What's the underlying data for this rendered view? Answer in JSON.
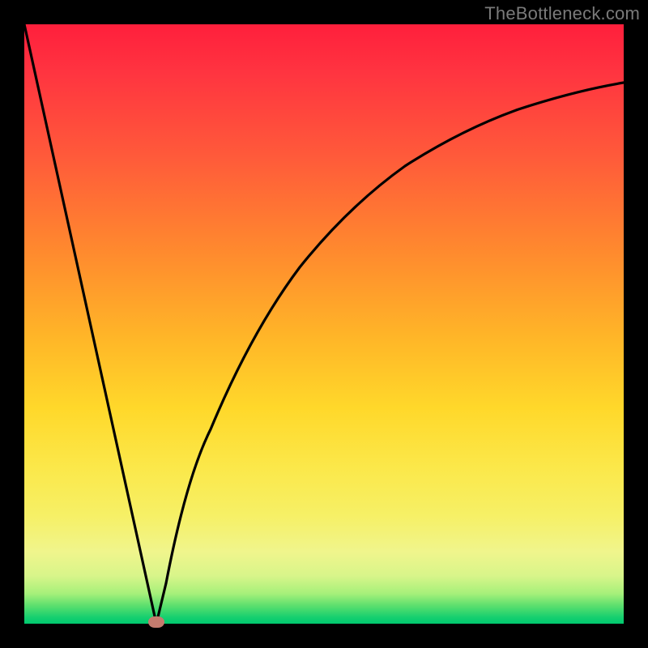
{
  "watermark": "TheBottleneck.com",
  "colors": {
    "curve": "#000000",
    "marker": "#c47b6e",
    "frame": "#000000"
  },
  "chart_data": {
    "type": "line",
    "title": "",
    "xlabel": "",
    "ylabel": "",
    "xlim": [
      0,
      100
    ],
    "ylim": [
      0,
      100
    ],
    "grid": false,
    "legend": false,
    "background_gradient": [
      "#ff1f3c",
      "#ff8a2e",
      "#ffd82a",
      "#f0f58c",
      "#00c96f"
    ],
    "series": [
      {
        "name": "left-branch",
        "x": [
          0,
          5,
          10,
          15,
          18,
          20,
          21,
          22
        ],
        "values": [
          100,
          77,
          54,
          31,
          17,
          8,
          3,
          0
        ]
      },
      {
        "name": "right-branch",
        "x": [
          22,
          24,
          27,
          30,
          35,
          40,
          45,
          50,
          55,
          60,
          65,
          70,
          75,
          80,
          85,
          90,
          95,
          100
        ],
        "values": [
          0,
          7,
          19,
          29,
          42,
          52,
          60,
          66,
          71,
          75,
          78,
          81,
          83,
          85,
          86.5,
          88,
          89,
          90
        ]
      }
    ],
    "marker": {
      "x": 22,
      "y": 0
    }
  }
}
